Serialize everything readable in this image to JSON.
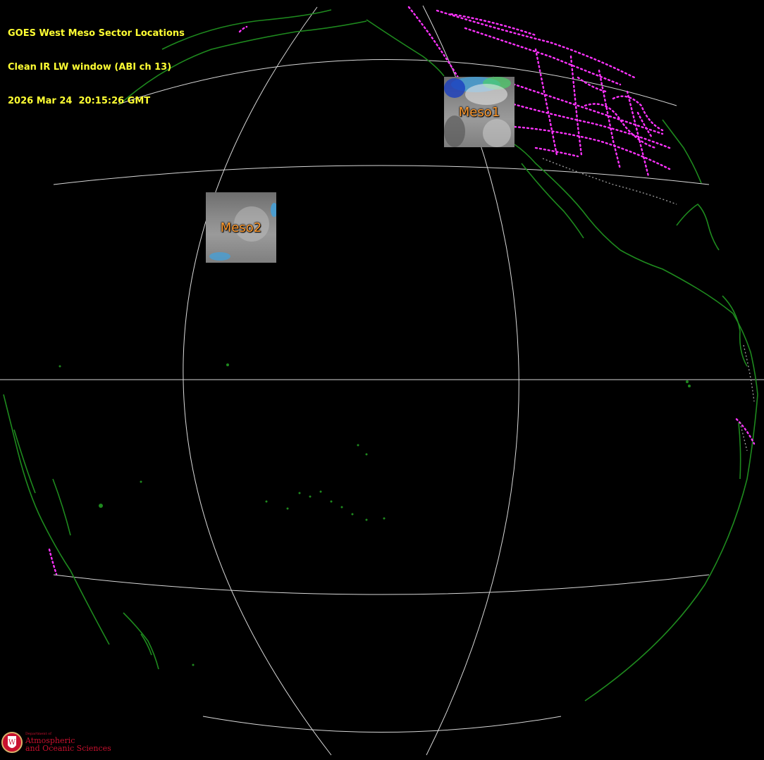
{
  "header": {
    "title": "GOES West Meso Sector Locations",
    "channel": "Clean IR LW window (ABI ch 13)",
    "timestamp": "2026 Mar 24  20:15:26 GMT"
  },
  "sectors": [
    {
      "id": "meso1",
      "label": "Meso1"
    },
    {
      "id": "meso2",
      "label": "Meso2"
    }
  ],
  "logo": {
    "department": "Department of",
    "line1": "Atmospheric",
    "line2": "and Oceanic Sciences",
    "seal_letter": "W"
  },
  "colors": {
    "background": "#000000",
    "header_text": "#ffff33",
    "coastline": "#1e8a1e",
    "borders": "#ff33ff",
    "gridlines": "#d8d8d8",
    "sector_label": "#ff9a2e",
    "logo": "#c8102e"
  }
}
